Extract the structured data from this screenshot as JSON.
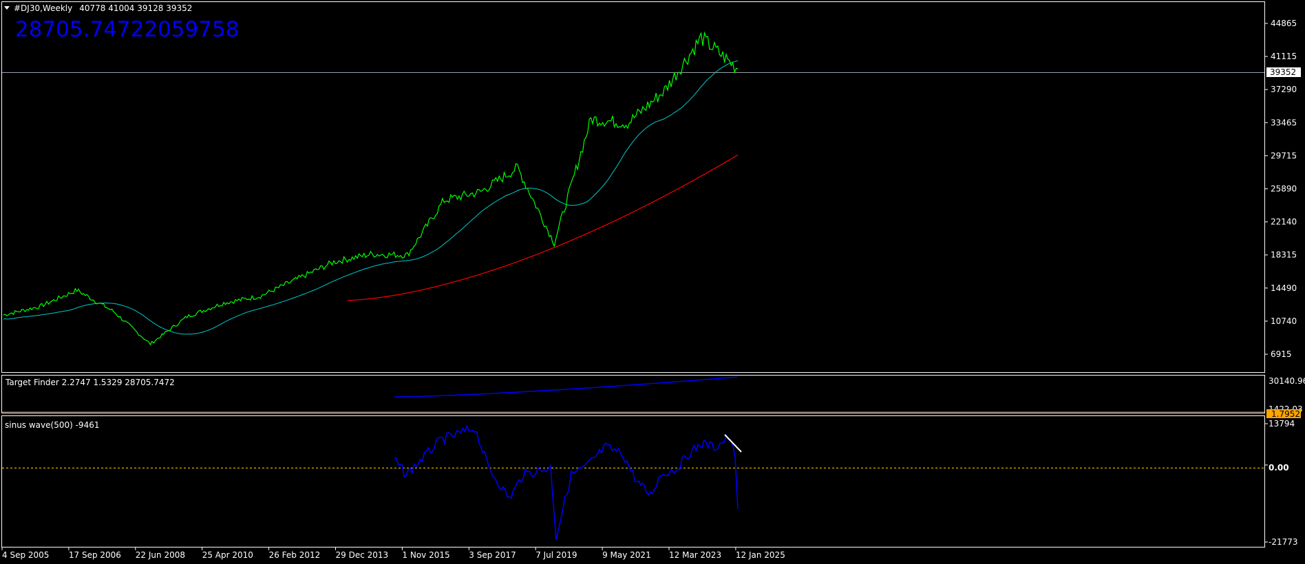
{
  "main_panel": {
    "title_prefix": "#DJ30,Weekly",
    "title_ohlc": "40778 41004 39128 39352",
    "big_value": "28705.74722059758",
    "price_labels": [
      "44865",
      "41115",
      "37290",
      "33465",
      "29715",
      "25890",
      "22140",
      "18315",
      "14490",
      "10740",
      "6915"
    ],
    "current_price": "39352"
  },
  "target_finder": {
    "label": "Target Finder 2.2747 1.5329 28705.7472",
    "scale_top": "30140.96",
    "scale_bottom": "1422.03",
    "badge": "1.7952"
  },
  "sinus_wave": {
    "label": "sinus wave(500) -9461",
    "scale_labels": [
      "13794",
      "0.00",
      "-21773"
    ]
  },
  "time_axis": {
    "labels": [
      "4 Sep 2005",
      "17 Sep 2006",
      "22 Jun 2008",
      "25 Apr 2010",
      "26 Feb 2012",
      "29 Dec 2013",
      "1 Nov 2015",
      "3 Sep 2017",
      "7 Jul 2019",
      "9 May 2021",
      "12 Mar 2023",
      "12 Jan 2025"
    ]
  },
  "colors": {
    "background": "#000000",
    "price": "#00ff00",
    "ma_fast": "#00cccc",
    "ma_slow": "#ff0000",
    "indicator": "#0000ff",
    "big_value": "#0000ff",
    "zero_line": "#ffd700",
    "badge": "#ffa500",
    "axis": "#ffffff"
  },
  "chart_data": {
    "type": "line",
    "title": "#DJ30,Weekly",
    "ylim": [
      4000,
      47000
    ],
    "x": [
      "2005",
      "2006",
      "2007",
      "2008",
      "2009",
      "2010",
      "2011",
      "2012",
      "2013",
      "2014",
      "2015",
      "2016",
      "2017",
      "2018",
      "2019",
      "2020",
      "2021",
      "2022",
      "2023",
      "2024",
      "2025"
    ],
    "series": [
      {
        "name": "#DJ30,Weekly",
        "values": [
          10600,
          11600,
          13500,
          11000,
          7200,
          10400,
          12000,
          12800,
          14800,
          16800,
          17700,
          17600,
          24000,
          25000,
          27800,
          19000,
          33500,
          33000,
          36800,
          43000,
          39352
        ]
      }
    ]
  }
}
